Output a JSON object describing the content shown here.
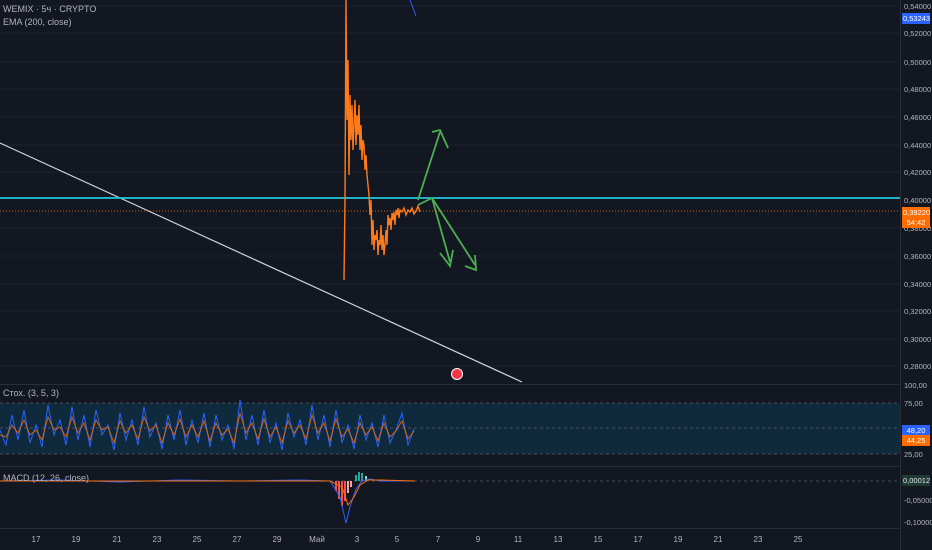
{
  "main": {
    "symbol_title": "WEMIX · 5ч · CRYPTO",
    "ema_label": "EMA (200, close)",
    "price_ticks": [
      "0,54000",
      "0,52000",
      "0,50000",
      "0,48000",
      "0,46000",
      "0,44000",
      "0,42000",
      "0,40000",
      "0,38000",
      "0,36000",
      "0,34000",
      "0,32000",
      "0,30000",
      "0,28000"
    ],
    "tag_ema": "0,53243",
    "tag_price": "0,39220",
    "tag_timer": "54:42"
  },
  "stoch": {
    "label": "Стох. (3, 5, 3)",
    "ticks": [
      "100,00",
      "75,00",
      "25,00"
    ],
    "tag_k": "48,20",
    "tag_d": "44,25"
  },
  "macd": {
    "label": "MACD (12, 26, close)",
    "tag_value": "0,00012",
    "ticks": [
      "-0,05000",
      "-0,10000"
    ]
  },
  "time_axis": {
    "labels": [
      "17",
      "19",
      "21",
      "23",
      "25",
      "27",
      "29",
      "Май",
      "3",
      "5",
      "7",
      "9",
      "11",
      "13",
      "15",
      "17",
      "19",
      "21",
      "23",
      "25"
    ]
  },
  "colors": {
    "background": "#131722",
    "price_line": "#ff7a1a",
    "support_line": "#26c6da",
    "trend_line": "#d1d4dc",
    "arrows": "#4caf50",
    "stoch_band": "#0f2a3d"
  }
}
